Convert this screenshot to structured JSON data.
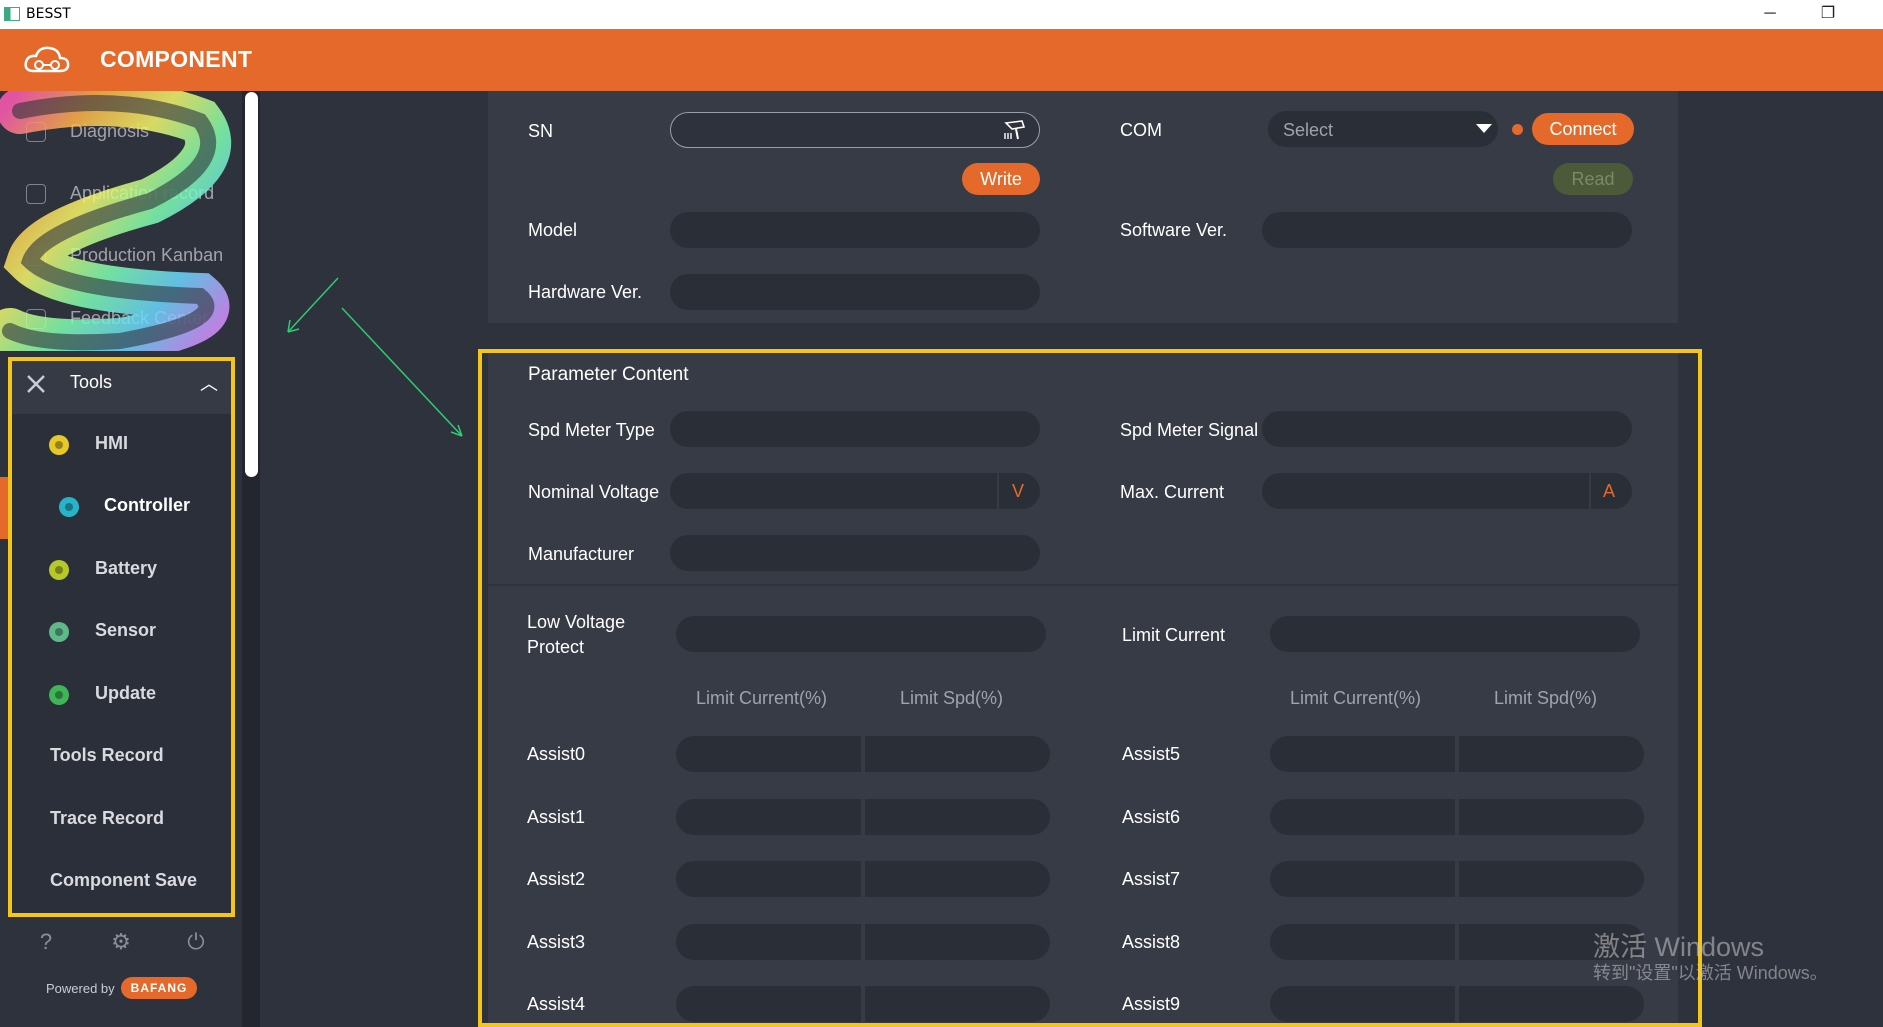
{
  "window": {
    "title": "BESST",
    "minimize": "─",
    "restore": "❐"
  },
  "header": {
    "brand": "COMPONENT"
  },
  "sidebar": {
    "faded_items": [
      "Diagnosis",
      "Application record",
      "Production Kanban",
      "Feedback Center"
    ],
    "tools_label": "Tools",
    "tools_items": [
      "HMI",
      "Controller",
      "Battery",
      "Sensor",
      "Update",
      "Tools Record",
      "Trace Record",
      "Component Save"
    ],
    "active_item": "Controller",
    "powered_by": "Powered by",
    "brand_badge": "BAFANG"
  },
  "device": {
    "sn_label": "SN",
    "sn_value": "",
    "com_label": "COM",
    "com_placeholder": "Select",
    "connect_label": "Connect",
    "write_label": "Write",
    "read_label": "Read",
    "model_label": "Model",
    "software_label": "Software Ver.",
    "hardware_label": "Hardware Ver."
  },
  "params": {
    "section_title": "Parameter Content",
    "spd_type_label": "Spd Meter Type",
    "spd_signal_label": "Spd Meter Signal",
    "nominal_voltage_label": "Nominal Voltage",
    "voltage_unit": "V",
    "max_current_label": "Max. Current",
    "current_unit": "A",
    "manufacturer_label": "Manufacturer",
    "low_voltage_label_1": "Low Voltage",
    "low_voltage_label_2": "Protect",
    "limit_current_label": "Limit Current",
    "col_limit_current": "Limit Current(%)",
    "col_limit_spd": "Limit Spd(%)",
    "assist_left": [
      "Assist0",
      "Assist1",
      "Assist2",
      "Assist3",
      "Assist4"
    ],
    "assist_right": [
      "Assist5",
      "Assist6",
      "Assist7",
      "Assist8",
      "Assist9"
    ]
  },
  "watermark": {
    "line1": "激活 Windows",
    "line2": "转到\"设置\"以激活 Windows。"
  },
  "colors": {
    "accent": "#e4692a",
    "highlight": "#f5c518",
    "read_btn": "#4c5a3a"
  }
}
